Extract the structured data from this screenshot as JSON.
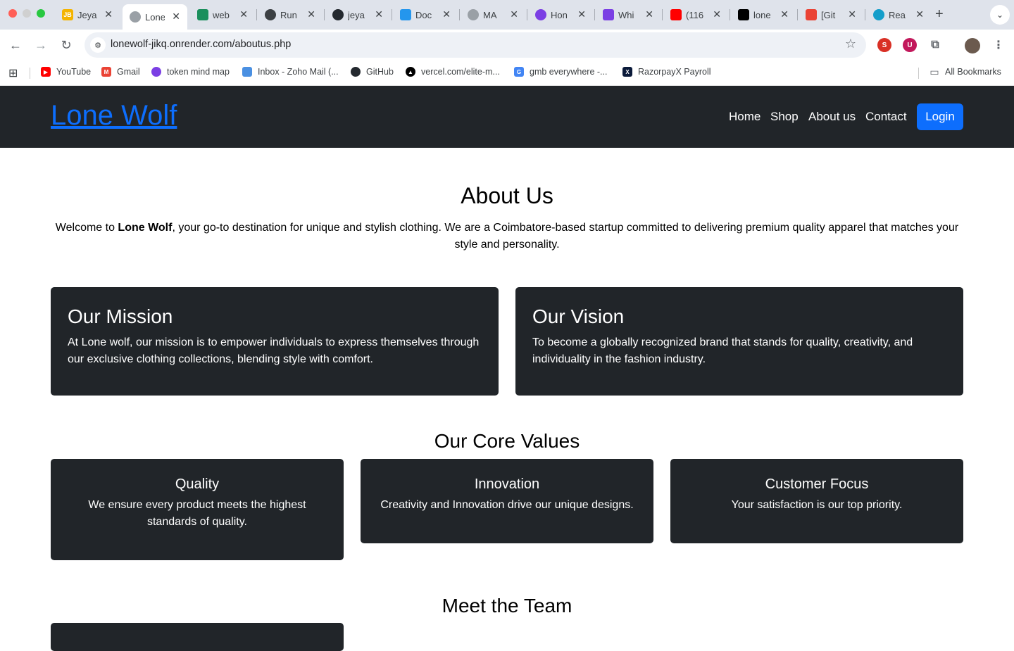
{
  "browser": {
    "tabs": [
      {
        "label": "Jeya",
        "favicon_color": "#f4b400",
        "favicon_text": "JB"
      },
      {
        "label": "Lone",
        "favicon_color": "#9aa0a6",
        "favicon_text": ""
      },
      {
        "label": "web",
        "favicon_color": "#1a8f5c",
        "favicon_text": ""
      },
      {
        "label": "Run",
        "favicon_color": "#3c4043",
        "favicon_text": ""
      },
      {
        "label": "jeya",
        "favicon_color": "#24292f",
        "favicon_text": ""
      },
      {
        "label": "Doc",
        "favicon_color": "#2496ed",
        "favicon_text": ""
      },
      {
        "label": "MA",
        "favicon_color": "#9aa0a6",
        "favicon_text": ""
      },
      {
        "label": "Hon",
        "favicon_color": "#7b3fe4",
        "favicon_text": ""
      },
      {
        "label": "Whi",
        "favicon_color": "#7b3fe4",
        "favicon_text": ""
      },
      {
        "label": "(116",
        "favicon_color": "#ff0000",
        "favicon_text": ""
      },
      {
        "label": "lone",
        "favicon_color": "#000000",
        "favicon_text": ""
      },
      {
        "label": "[Git",
        "favicon_color": "#ea4335",
        "favicon_text": ""
      },
      {
        "label": "Rea",
        "favicon_color": "#149eca",
        "favicon_text": ""
      }
    ],
    "url": "lonewolf-jikq.onrender.com/aboutus.php",
    "bookmarks": [
      {
        "label": "YouTube",
        "color": "#ff0000"
      },
      {
        "label": "Gmail",
        "color": "#ea4335"
      },
      {
        "label": "token mind map",
        "color": "#7b3fe4"
      },
      {
        "label": "Inbox - Zoho Mail (...",
        "color": "#4a90e2"
      },
      {
        "label": "GitHub",
        "color": "#24292f"
      },
      {
        "label": "vercel.com/elite-m...",
        "color": "#000000"
      },
      {
        "label": "gmb everywhere -...",
        "color": "#4285f4"
      },
      {
        "label": "RazorpayX Payroll",
        "color": "#0b1a3a"
      }
    ],
    "all_bookmarks": "All Bookmarks",
    "extensions": [
      {
        "name": "seo-extension-icon",
        "color": "#d93025",
        "text": "S"
      },
      {
        "name": "ublock-extension-icon",
        "color": "#c2185b",
        "text": "U"
      }
    ]
  },
  "site": {
    "brand": "Lone Wolf",
    "nav": [
      "Home",
      "Shop",
      "About us",
      "Contact"
    ],
    "login": "Login",
    "page_title": "About Us",
    "intro_before": "Welcome to ",
    "intro_brand": "Lone Wolf",
    "intro_after": ", your go-to destination for unique and stylish clothing. We are a Coimbatore-based startup committed to delivering premium quality apparel that matches your style and personality.",
    "mission": {
      "title": "Our Mission",
      "text": "At Lone wolf, our mission is to empower individuals to express themselves through our exclusive clothing collections, blending style with comfort."
    },
    "vision": {
      "title": "Our Vision",
      "text": "To become a globally recognized brand that stands for quality, creativity, and individuality in the fashion industry."
    },
    "core_values_title": "Our Core Values",
    "core_values": [
      {
        "title": "Quality",
        "text": "We ensure every product meets the highest standards of quality."
      },
      {
        "title": "Innovation",
        "text": "Creativity and Innovation drive our unique designs."
      },
      {
        "title": "Customer Focus",
        "text": "Your satisfaction is our top priority."
      }
    ],
    "team_title": "Meet the Team"
  }
}
